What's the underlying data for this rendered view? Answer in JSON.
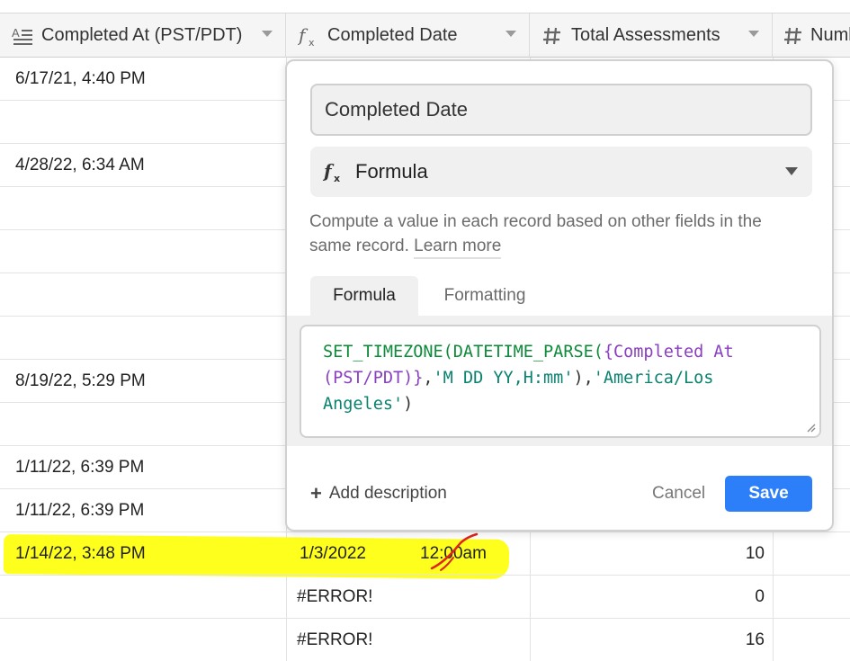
{
  "columns": [
    {
      "label": "Completed At (PST/PDT)",
      "icon": "long-text-icon"
    },
    {
      "label": "Completed Date",
      "icon": "formula-icon"
    },
    {
      "label": "Total Assessments",
      "icon": "number-icon"
    },
    {
      "label": "Numb",
      "icon": "number-icon"
    }
  ],
  "rows": [
    {
      "completed_at": "6/17/21, 4:40 PM",
      "completed_date": "",
      "total": ""
    },
    {
      "completed_at": "",
      "completed_date": "",
      "total": ""
    },
    {
      "completed_at": "4/28/22, 6:34 AM",
      "completed_date": "",
      "total": ""
    },
    {
      "completed_at": "",
      "completed_date": "",
      "total": ""
    },
    {
      "completed_at": "",
      "completed_date": "",
      "total": ""
    },
    {
      "completed_at": "",
      "completed_date": "",
      "total": ""
    },
    {
      "completed_at": "",
      "completed_date": "",
      "total": ""
    },
    {
      "completed_at": "8/19/22, 5:29 PM",
      "completed_date": "",
      "total": ""
    },
    {
      "completed_at": "",
      "completed_date": "",
      "total": ""
    },
    {
      "completed_at": "1/11/22, 6:39 PM",
      "completed_date": "",
      "total": ""
    },
    {
      "completed_at": "1/11/22, 6:39 PM",
      "completed_date": "",
      "total": ""
    },
    {
      "completed_at": "1/14/22, 3:48 PM",
      "completed_date": "1/3/2022",
      "completed_time": "12:00am",
      "total": "10"
    },
    {
      "completed_at": "",
      "completed_date": "#ERROR!",
      "total": "0"
    },
    {
      "completed_at": "",
      "completed_date": "#ERROR!",
      "total": "16"
    }
  ],
  "field_editor": {
    "name_value": "Completed Date",
    "type_label": "Formula",
    "type_icon": "formula-icon",
    "description_text": "Compute a value in each record based on other fields in the same record.",
    "learn_more": "Learn more",
    "tabs": [
      "Formula",
      "Formatting"
    ],
    "formula": {
      "fn1": "SET_TIMEZONE(",
      "fn2": "DATETIME_PARSE(",
      "field": "{Completed At (PST/PDT)}",
      "comma1": ",",
      "str1": "'M DD YY,H:mm'",
      "close1": "),",
      "str2": "'America/Los Angeles'",
      "close2": ")"
    },
    "add_description": "Add description",
    "cancel_label": "Cancel",
    "save_label": "Save"
  },
  "colors": {
    "highlight": "#ffff1e",
    "save_button": "#2d7ff9",
    "formula_function": "#0e8a3a",
    "formula_field": "#8a3fc2",
    "formula_string": "#0a8270",
    "annotation_stroke": "#e0241c"
  }
}
